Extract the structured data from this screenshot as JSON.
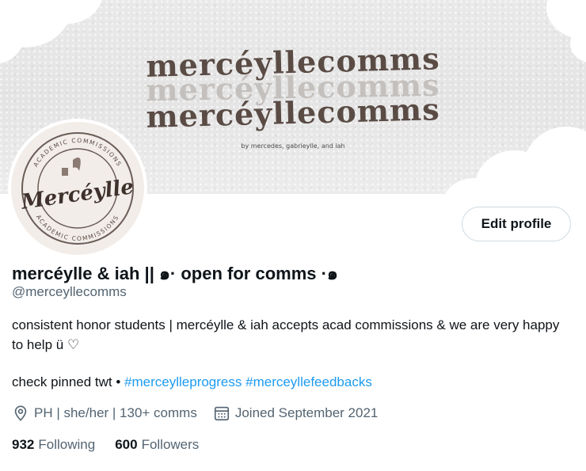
{
  "banner": {
    "title_line1": "mercéyllecomms",
    "title_line2": "mercéyllecomms",
    "title_line3": "mercéyllecomms",
    "subtitle": "by mercedes, gabrieylle, and iah"
  },
  "avatar": {
    "logo_text": "Mercéylle",
    "ring_text_top": "ACADEMIC COMMISSIONS",
    "ring_text_bottom": "ACADEMIC COMMISSIONS"
  },
  "profile": {
    "edit_label": "Edit profile",
    "display_name": "mercéylle & iah || ๑· open for comms ·๑",
    "handle": "@merceyllecomms",
    "bio_line": "consistent honor students | mercéylle & iah accepts acad commissions & we are very happy to help ü ♡",
    "pinned_text": "check pinned twt •",
    "hashtag1": "#merceylleprogress",
    "hashtag2": "#merceyllefeedbacks",
    "location": "PH | she/her | 130+ comms",
    "joined": "Joined September 2021",
    "following_count": "932",
    "following_label": "Following",
    "followers_count": "600",
    "followers_label": "Followers"
  },
  "colors": {
    "accent": "#1d9bf0",
    "muted": "#536471",
    "text": "#0f1419",
    "banner_brown": "#5a4b45"
  },
  "icons": {
    "location": "location-pin-icon",
    "calendar": "calendar-icon"
  }
}
